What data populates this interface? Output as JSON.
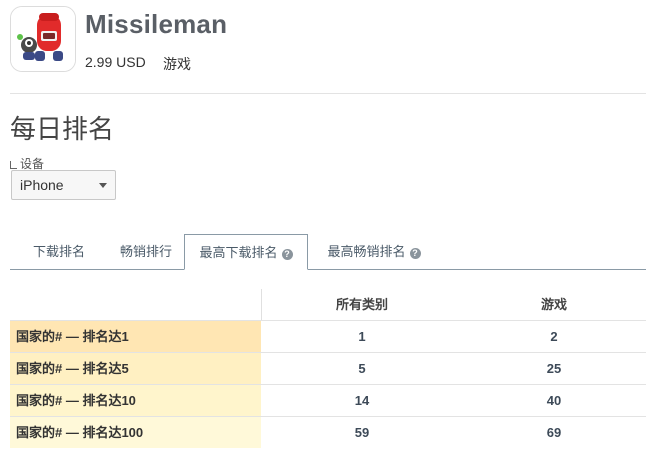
{
  "app": {
    "name": "Missileman",
    "price": "2.99 USD",
    "category": "游戏",
    "icon": "missile-robot-app-icon"
  },
  "section": {
    "title": "每日排名"
  },
  "device": {
    "label": "设备",
    "selected": "iPhone"
  },
  "tabs": [
    {
      "label": "下载排名",
      "help": false
    },
    {
      "label": "畅销排行",
      "help": false
    },
    {
      "label": "最高下载排名",
      "help": true,
      "active": true
    },
    {
      "label": "最高畅销排名",
      "help": true
    }
  ],
  "table": {
    "headers": [
      "",
      "所有类别",
      "游戏"
    ],
    "rows": [
      {
        "label": "国家的# — 排名达1",
        "all": "1",
        "games": "2",
        "color": "#ffe6b3"
      },
      {
        "label": "国家的# — 排名达5",
        "all": "5",
        "games": "25",
        "color": "#fff0c2"
      },
      {
        "label": "国家的# — 排名达10",
        "all": "14",
        "games": "40",
        "color": "#fff5cc"
      },
      {
        "label": "国家的# — 排名达100",
        "all": "59",
        "games": "69",
        "color": "#fff9d9"
      }
    ]
  },
  "colors": {
    "tab_border": "#8a9aa6",
    "title_gray": "#5a5f66"
  }
}
